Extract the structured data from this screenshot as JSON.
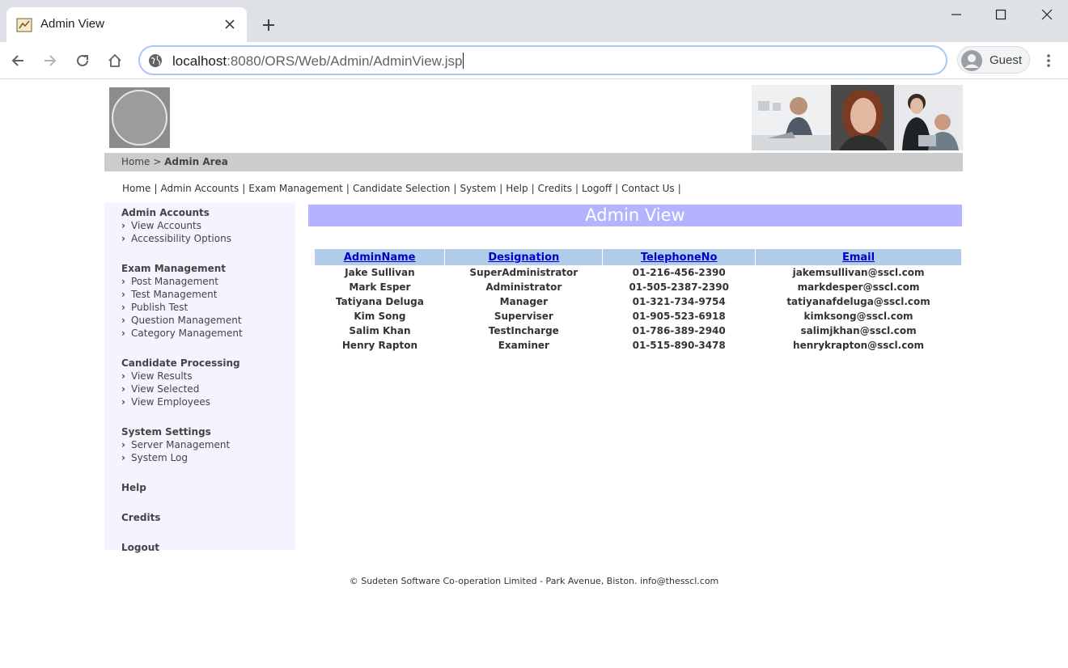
{
  "browser": {
    "tab_title": "Admin View",
    "url_host": "localhost",
    "url_rest": ":8080/ORS/Web/Admin/AdminView.jsp",
    "profile_label": "Guest"
  },
  "breadcrumb": {
    "home": "Home >",
    "current": "Admin Area"
  },
  "topnav": [
    "Home",
    "Admin Accounts",
    "Exam Management",
    "Candidate Selection",
    "System",
    "Help",
    "Credits",
    "Logoff",
    "Contact Us"
  ],
  "sidebar": {
    "sections": [
      {
        "title": "Admin Accounts",
        "items": [
          "View Accounts",
          "Accessibility Options"
        ]
      },
      {
        "title": "Exam Management",
        "items": [
          "Post Management",
          "Test Management",
          "Publish Test",
          "Question Management",
          "Category Management"
        ]
      },
      {
        "title": "Candidate Processing",
        "items": [
          "View Results",
          "View Selected",
          "View Employees"
        ]
      },
      {
        "title": "System Settings",
        "items": [
          "Server Management",
          "System Log"
        ]
      },
      {
        "title": "Help",
        "items": []
      },
      {
        "title": "Credits",
        "items": []
      },
      {
        "title": "Logout",
        "items": []
      }
    ]
  },
  "main": {
    "title": "Admin View",
    "columns": [
      "AdminName",
      "Designation",
      "TelephoneNo",
      "Email"
    ],
    "rows": [
      [
        "Jake Sullivan",
        "SuperAdministrator",
        "01-216-456-2390",
        "jakemsullivan@sscl.com"
      ],
      [
        "Mark Esper",
        "Administrator",
        "01-505-2387-2390",
        "markdesper@sscl.com"
      ],
      [
        "Tatiyana Deluga",
        "Manager",
        "01-321-734-9754",
        "tatiyanafdeluga@sscl.com"
      ],
      [
        "Kim Song",
        "Superviser",
        "01-905-523-6918",
        "kimksong@sscl.com"
      ],
      [
        "Salim Khan",
        "TestIncharge",
        "01-786-389-2940",
        "salimjkhan@sscl.com"
      ],
      [
        "Henry Rapton",
        "Examiner",
        "01-515-890-3478",
        "henrykrapton@sscl.com"
      ]
    ]
  },
  "footer": "© Sudeten Software Co-operation Limited - Park Avenue, Biston. info@thesscl.com"
}
